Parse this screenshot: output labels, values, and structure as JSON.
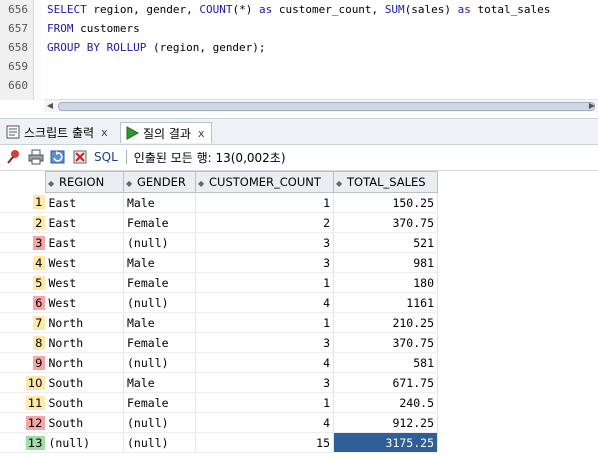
{
  "editor": {
    "lines": [
      {
        "num": "656",
        "tokens": [
          [
            "kw",
            "SELECT"
          ],
          [
            "op",
            " region, gender, "
          ],
          [
            "kw",
            "COUNT"
          ],
          [
            "op",
            "(*) "
          ],
          [
            "kw",
            "as"
          ],
          [
            "op",
            " customer_count, "
          ],
          [
            "kw",
            "SUM"
          ],
          [
            "op",
            "(sales) "
          ],
          [
            "kw",
            "as"
          ],
          [
            "op",
            " total_sales"
          ]
        ]
      },
      {
        "num": "657",
        "tokens": [
          [
            "kw",
            "FROM"
          ],
          [
            "op",
            " customers"
          ]
        ]
      },
      {
        "num": "658",
        "tokens": [
          [
            "kw",
            "GROUP BY ROLLUP"
          ],
          [
            "op",
            " (region, gender);"
          ]
        ]
      },
      {
        "num": "659",
        "tokens": []
      },
      {
        "num": "660",
        "tokens": []
      }
    ]
  },
  "tabs": [
    {
      "label": "스크립트 출력",
      "close": "x",
      "icon": "script-output-icon",
      "active": false
    },
    {
      "label": "질의 결과",
      "close": "x",
      "icon": "run-query-icon",
      "active": true
    }
  ],
  "toolbar": {
    "sql_label": "SQL",
    "status": "인출된 모든 행: 13(0,002초)"
  },
  "grid": {
    "columns": [
      "REGION",
      "GENDER",
      "CUSTOMER_COUNT",
      "TOTAL_SALES"
    ],
    "rows": [
      {
        "n": "1",
        "mark": "#ffe9a8",
        "region": "East",
        "gender": "Male",
        "count": "1",
        "sales": "150.25"
      },
      {
        "n": "2",
        "mark": "#ffe9a8",
        "region": "East",
        "gender": "Female",
        "count": "2",
        "sales": "370.75"
      },
      {
        "n": "3",
        "mark": "#f7a6a6",
        "region": "East",
        "gender": "(null)",
        "count": "3",
        "sales": "521"
      },
      {
        "n": "4",
        "mark": "#ffe9a8",
        "region": "West",
        "gender": "Male",
        "count": "3",
        "sales": "981"
      },
      {
        "n": "5",
        "mark": "#ffe9a8",
        "region": "West",
        "gender": "Female",
        "count": "1",
        "sales": "180"
      },
      {
        "n": "6",
        "mark": "#f7a6a6",
        "region": "West",
        "gender": "(null)",
        "count": "4",
        "sales": "1161"
      },
      {
        "n": "7",
        "mark": "#ffe9a8",
        "region": "North",
        "gender": "Male",
        "count": "1",
        "sales": "210.25"
      },
      {
        "n": "8",
        "mark": "#ffe9a8",
        "region": "North",
        "gender": "Female",
        "count": "3",
        "sales": "370.75"
      },
      {
        "n": "9",
        "mark": "#f7a6a6",
        "region": "North",
        "gender": "(null)",
        "count": "4",
        "sales": "581"
      },
      {
        "n": "10",
        "mark": "#ffe9a8",
        "region": "South",
        "gender": "Male",
        "count": "3",
        "sales": "671.75"
      },
      {
        "n": "11",
        "mark": "#ffe9a8",
        "region": "South",
        "gender": "Female",
        "count": "1",
        "sales": "240.5"
      },
      {
        "n": "12",
        "mark": "#f7a6a6",
        "region": "South",
        "gender": "(null)",
        "count": "4",
        "sales": "912.25"
      },
      {
        "n": "13",
        "mark": "#9fdca6",
        "region": "(null)",
        "gender": "(null)",
        "count": "15",
        "sales": "3175.25"
      }
    ],
    "selected_cell": {
      "row": 12,
      "col": "sales"
    },
    "selection_color": "#2f5f96"
  }
}
